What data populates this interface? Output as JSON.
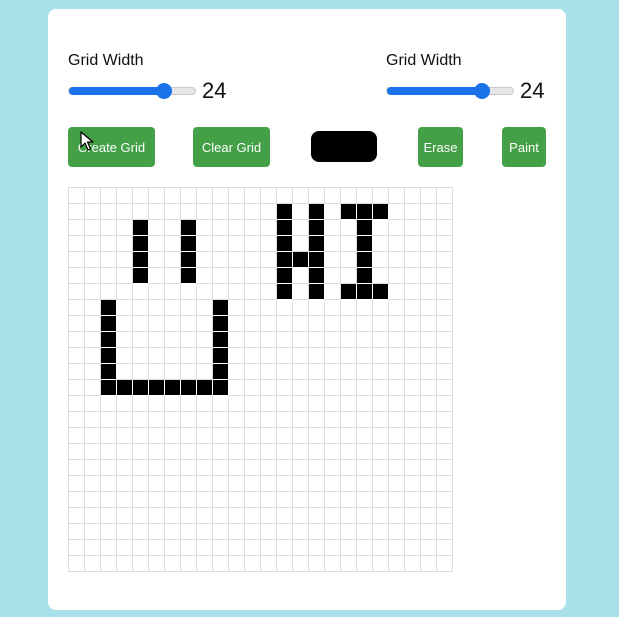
{
  "controls": {
    "width_slider": {
      "label": "Grid Width",
      "value": "24",
      "min": 1,
      "max": 32,
      "current": 24
    },
    "height_slider": {
      "label": "Grid Width",
      "value": "24",
      "min": 1,
      "max": 32,
      "current": 24
    }
  },
  "buttons": {
    "create": "Create Grid",
    "clear": "Clear Grid",
    "erase": "Erase",
    "paint": "Paint"
  },
  "color_picker": {
    "value": "#000000"
  },
  "grid": {
    "rows": 24,
    "cols": 24,
    "paint_color": "#000000",
    "painted": [
      [
        1,
        13
      ],
      [
        1,
        15
      ],
      [
        1,
        17
      ],
      [
        1,
        18
      ],
      [
        1,
        19
      ],
      [
        2,
        4
      ],
      [
        2,
        7
      ],
      [
        2,
        13
      ],
      [
        2,
        15
      ],
      [
        2,
        18
      ],
      [
        3,
        4
      ],
      [
        3,
        7
      ],
      [
        3,
        13
      ],
      [
        3,
        15
      ],
      [
        3,
        18
      ],
      [
        4,
        4
      ],
      [
        4,
        7
      ],
      [
        4,
        13
      ],
      [
        4,
        14
      ],
      [
        4,
        15
      ],
      [
        4,
        18
      ],
      [
        5,
        4
      ],
      [
        5,
        7
      ],
      [
        5,
        13
      ],
      [
        5,
        15
      ],
      [
        5,
        18
      ],
      [
        6,
        13
      ],
      [
        6,
        15
      ],
      [
        6,
        17
      ],
      [
        6,
        18
      ],
      [
        6,
        19
      ],
      [
        7,
        2
      ],
      [
        7,
        9
      ],
      [
        8,
        2
      ],
      [
        8,
        9
      ],
      [
        9,
        2
      ],
      [
        9,
        9
      ],
      [
        10,
        2
      ],
      [
        10,
        9
      ],
      [
        11,
        2
      ],
      [
        11,
        9
      ],
      [
        12,
        2
      ],
      [
        12,
        3
      ],
      [
        12,
        4
      ],
      [
        12,
        5
      ],
      [
        12,
        6
      ],
      [
        12,
        7
      ],
      [
        12,
        8
      ],
      [
        12,
        9
      ]
    ]
  }
}
